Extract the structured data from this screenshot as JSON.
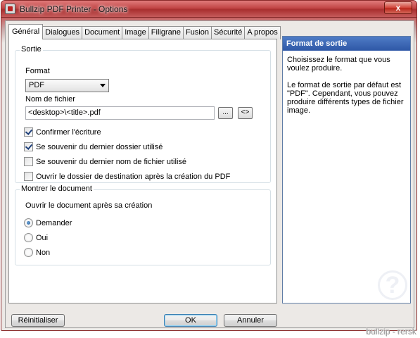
{
  "window": {
    "title": "Bullzip PDF Printer - Options",
    "close_label": "x"
  },
  "tabs": [
    {
      "label": "Général"
    },
    {
      "label": "Dialogues"
    },
    {
      "label": "Document"
    },
    {
      "label": "Image"
    },
    {
      "label": "Filigrane"
    },
    {
      "label": "Fusion"
    },
    {
      "label": "Sécurité"
    },
    {
      "label": "A propos"
    }
  ],
  "output": {
    "group_title": "Sortie",
    "format_label": "Format",
    "format_value": "PDF",
    "filename_label": "Nom de fichier",
    "filename_value": "<desktop>\\<title>.pdf",
    "browse_label": "...",
    "macro_label": "<>",
    "options": [
      {
        "label": "Confirmer l'écriture",
        "checked": true
      },
      {
        "label": "Se souvenir du dernier dossier utilisé",
        "checked": true
      },
      {
        "label": "Se souvenir du dernier nom de fichier utilisé",
        "checked": false
      },
      {
        "label": "Ouvrir le dossier de destination après la création du PDF",
        "checked": false
      }
    ]
  },
  "show_document": {
    "group_title": "Montrer le document",
    "prompt": "Ouvrir le document après sa création",
    "choices": [
      {
        "label": "Demander",
        "selected": true
      },
      {
        "label": "Oui",
        "selected": false
      },
      {
        "label": "Non",
        "selected": false
      }
    ]
  },
  "help": {
    "title": "Format de sortie",
    "paragraphs": [
      "Choisissez le format que vous voulez produire.",
      "Le format de sortie par défaut est \"PDF\". Cependant, vous pouvez produire différents types de fichier image."
    ],
    "icon": "question-mark-icon"
  },
  "buttons": {
    "reset": "Réinitialiser",
    "ok": "OK",
    "cancel": "Annuler"
  },
  "watermark": "bullzip - rersk",
  "colors": {
    "titlebar": "#c24747",
    "help_header": "#3a66b3",
    "default_button_border": "#3c7fb1"
  }
}
